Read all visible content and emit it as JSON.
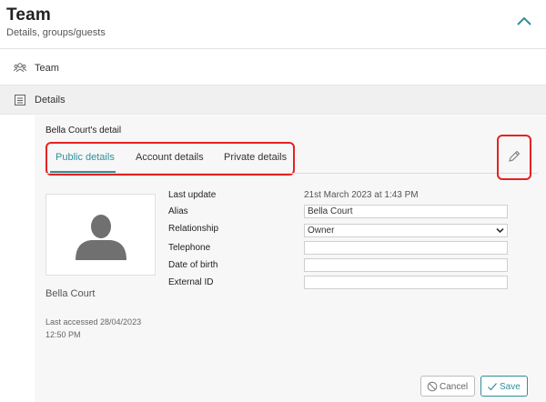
{
  "header": {
    "title": "Team",
    "subtitle": "Details, groups/guests"
  },
  "nav": {
    "team_label": "Team",
    "details_label": "Details"
  },
  "panel": {
    "title": "Bella Court's detail",
    "tabs": [
      {
        "label": "Public details",
        "active": true
      },
      {
        "label": "Account details",
        "active": false
      },
      {
        "label": "Private details",
        "active": false
      }
    ],
    "profile": {
      "name": "Bella Court",
      "last_accessed_line1": "Last accessed 28/04/2023",
      "last_accessed_line2": "12:50 PM"
    },
    "fields": {
      "last_update": {
        "label": "Last update",
        "value": "21st March 2023 at 1:43 PM"
      },
      "alias": {
        "label": "Alias",
        "value": "Bella Court"
      },
      "relationship": {
        "label": "Relationship",
        "value": "Owner"
      },
      "telephone": {
        "label": "Telephone",
        "value": ""
      },
      "date_of_birth": {
        "label": "Date of birth",
        "value": ""
      },
      "external_id": {
        "label": "External ID",
        "value": ""
      }
    },
    "buttons": {
      "cancel": "Cancel",
      "save": "Save"
    }
  },
  "colors": {
    "accent": "#2f8f9a",
    "highlight": "#e52222",
    "panel_bg": "#f7f7f7"
  },
  "icons": {
    "collapse": "chevron-up-icon",
    "team": "people-icon",
    "details": "list-icon",
    "edit": "pencil-icon",
    "cancel": "ban-icon",
    "save": "check-icon"
  }
}
